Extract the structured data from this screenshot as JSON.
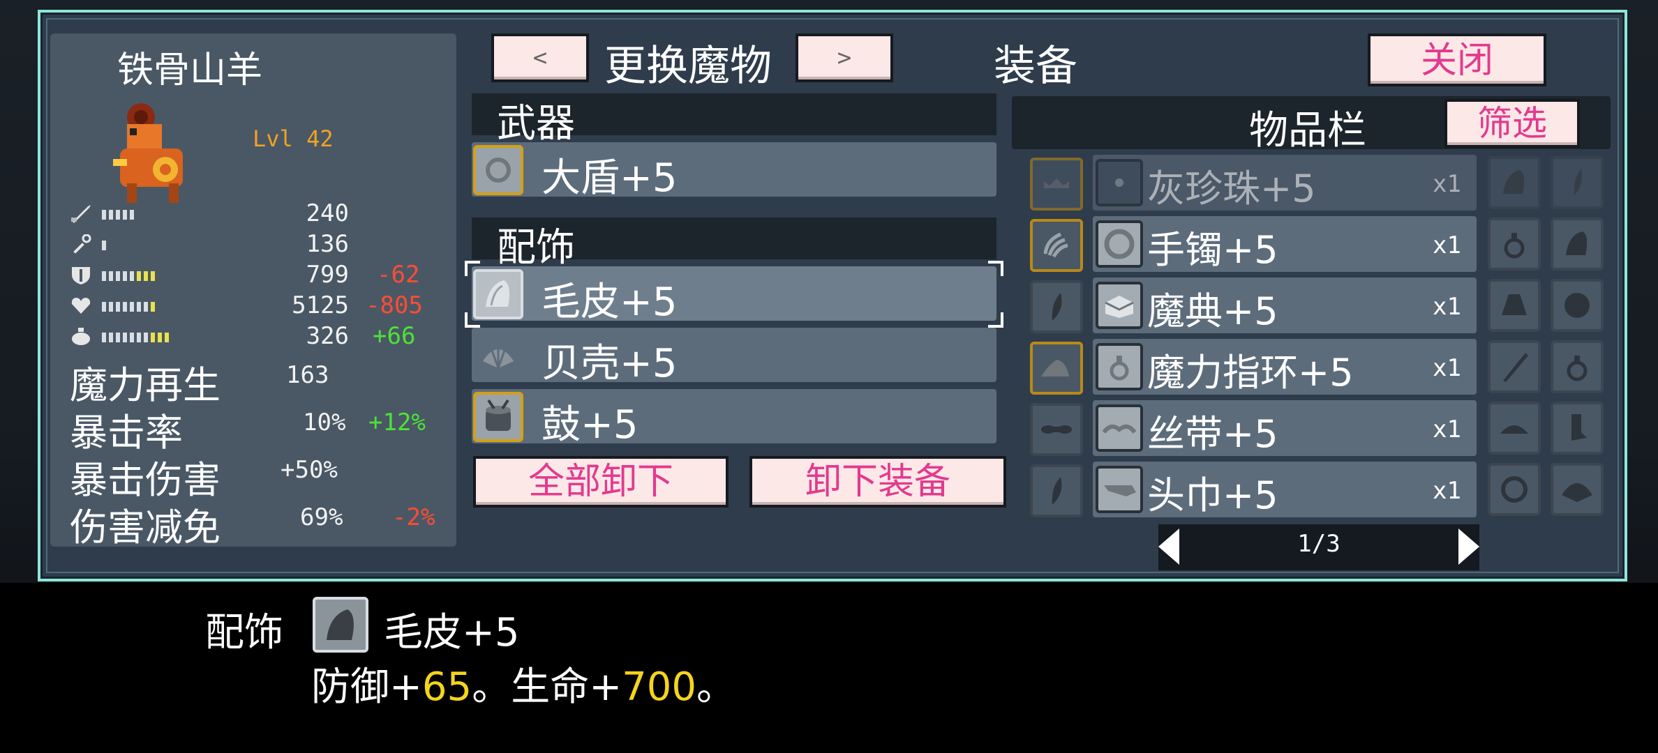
{
  "monster": {
    "name": "铁骨山羊",
    "level": "Lvl 42",
    "stats": [
      {
        "icon": "sword-attack-icon",
        "value": "240",
        "delta": ""
      },
      {
        "icon": "wand-magic-icon",
        "value": "136",
        "delta": ""
      },
      {
        "icon": "shield-defense-icon",
        "value": "799",
        "delta": "-62"
      },
      {
        "icon": "heart-health-icon",
        "value": "5125",
        "delta": "-805"
      },
      {
        "icon": "potion-mana-icon",
        "value": "326",
        "delta": "+66"
      }
    ],
    "attributes": [
      {
        "name": "魔力再生",
        "value": "163",
        "delta": ""
      },
      {
        "name": "暴击率",
        "value": "10%",
        "delta": "+12%"
      },
      {
        "name": "暴击伤害",
        "value": "+50%",
        "delta": ""
      },
      {
        "name": "伤害减免",
        "value": "69%",
        "delta": "-2%"
      }
    ]
  },
  "header": {
    "prev_label": "<",
    "change_label": "更换魔物",
    "next_label": ">",
    "title": "装备",
    "close_label": "关闭"
  },
  "equipment": {
    "weapon_header": "武器",
    "weapon": {
      "icon": "round-shield-icon",
      "label": "大盾+5"
    },
    "accessory_header": "配饰",
    "accessories": [
      {
        "icon": "fur-pelt-icon",
        "label": "毛皮+5",
        "selected": true
      },
      {
        "icon": "seashell-icon",
        "label": "贝壳+5",
        "selected": false
      },
      {
        "icon": "drum-icon",
        "label": "鼓+5",
        "selected": false
      }
    ],
    "unequip_all_label": "全部卸下",
    "unequip_label": "卸下装备"
  },
  "inventory": {
    "title": "物品栏",
    "filter_label": "筛选",
    "rows": [
      {
        "category_icon": "crown-category-icon",
        "icon": "gray-pearl-icon",
        "name": "灰珍珠+5",
        "qty": "x1",
        "side_icons": [
          "fur-pelt-icon",
          "feather-icon"
        ]
      },
      {
        "category_icon": "claw-category-icon",
        "icon": "bracelet-icon",
        "name": "手镯+5",
        "qty": "x1",
        "side_icons": [
          "ring-icon",
          "fur-pelt-icon"
        ]
      },
      {
        "category_icon": "feather-category-icon",
        "icon": "grimoire-icon",
        "name": "魔典+5",
        "qty": "x1",
        "side_icons": [
          "bell-icon",
          "orb-icon"
        ]
      },
      {
        "category_icon": "fin-category-icon",
        "icon": "magic-ring-icon",
        "name": "魔力指环+5",
        "qty": "x1",
        "side_icons": [
          "quill-icon",
          "ring-icon"
        ]
      },
      {
        "category_icon": "bow-category-icon",
        "icon": "ribbon-icon",
        "name": "丝带+5",
        "qty": "x1",
        "side_icons": [
          "hat-icon",
          "boot-icon"
        ]
      },
      {
        "category_icon": "feather-category-icon",
        "icon": "headscarf-icon",
        "name": "头巾+5",
        "qty": "x1",
        "side_icons": [
          "bracelet-icon",
          "seashell-icon"
        ]
      }
    ],
    "page": "1/3"
  },
  "description": {
    "slot": "配饰",
    "icon": "fur-pelt-icon",
    "name": "毛皮+5",
    "stat1_label": "防御+",
    "stat1_value": "65",
    "sep1": "。",
    "stat2_label": "生命+",
    "stat2_value": "700",
    "sep2": "。"
  },
  "colors": {
    "frame": "#8fe6d8",
    "panel": "#2f3c4b",
    "button_text": "#e23a8e",
    "level": "#f0a41f",
    "negative": "#ff4c33",
    "positive": "#4de236",
    "highlight": "#f5d51c"
  }
}
